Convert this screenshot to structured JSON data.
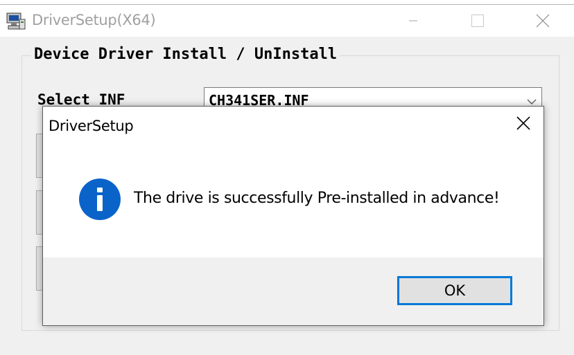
{
  "main_window": {
    "title": "DriverSetup(X64)",
    "group_title": "Device Driver Install / UnInstall",
    "select_label": "Select INF",
    "inf_value": "CH341SER.INF",
    "caption_icons": [
      "minimize-icon",
      "maximize-icon",
      "close-icon"
    ]
  },
  "dialog": {
    "title": "DriverSetup",
    "message": "The drive is successfully Pre-installed in advance!",
    "ok_label": "OK",
    "icon": "information-icon"
  },
  "colors": {
    "accent": "#0078d7",
    "info_icon": "#0a63c9",
    "face": "#f0f0f0"
  }
}
